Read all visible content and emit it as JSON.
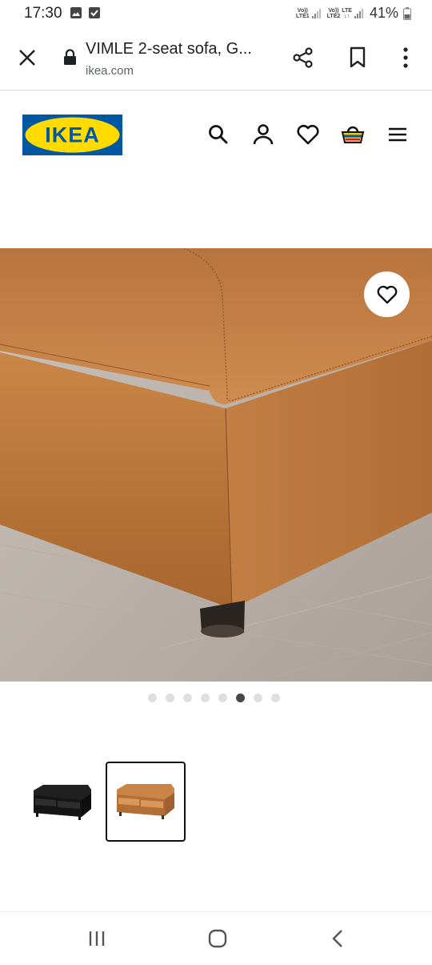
{
  "status_bar": {
    "time": "17:30",
    "sim1_top": "Vo))",
    "sim1_bottom": "LTE1",
    "sim2_top": "Vo))",
    "sim2_bottom": "LTE2",
    "network_top": "LTE",
    "network_bottom": "↓↑",
    "battery": "41%"
  },
  "browser": {
    "page_title": "VIMLE 2-seat sofa, G...",
    "host": "ikea.com"
  },
  "site": {
    "logo_text": "IKEA",
    "logo_colors": {
      "blue": "#0058a3",
      "yellow": "#ffdb00"
    },
    "header_icons": [
      "search-icon",
      "account-icon",
      "favourites-icon",
      "shopping-bag-icon",
      "menu-icon"
    ]
  },
  "gallery": {
    "dot_count": 8,
    "active_dot_index": 5,
    "thumbnails": [
      {
        "name": "black-leather-sofa",
        "color": "#1e1e1e",
        "selected": false
      },
      {
        "name": "golden-brown-leather-sofa",
        "color": "#c07a3f",
        "selected": true
      }
    ]
  },
  "colors": {
    "product_leather": "#bd7840",
    "floor": "#bdb4ad"
  }
}
